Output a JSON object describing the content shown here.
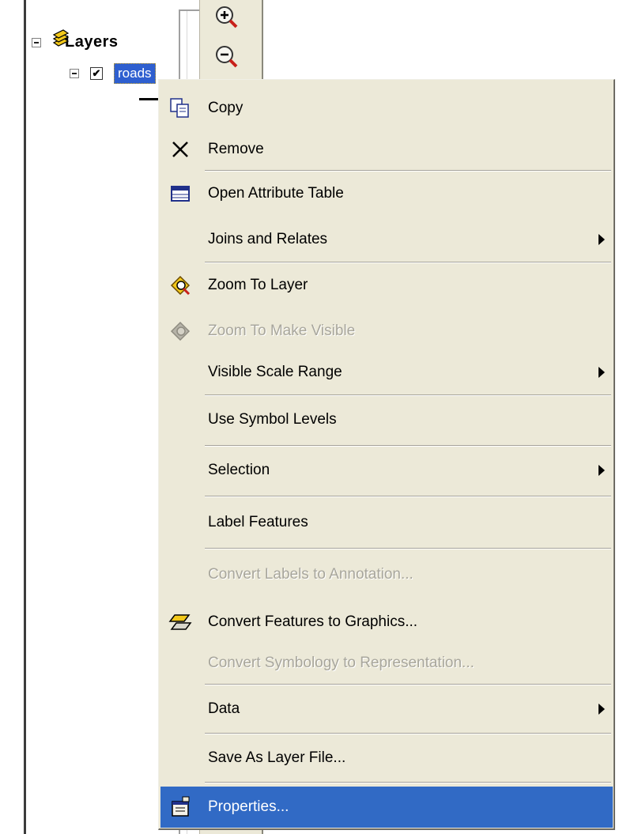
{
  "toc": {
    "root_label": "Layers",
    "layer_label": "roads",
    "layer_checked": "✔"
  },
  "toolbar": {
    "zoom_in_icon": "zoom-in-icon",
    "zoom_out_icon": "zoom-out-icon"
  },
  "menu": {
    "items": [
      {
        "label": "Copy",
        "icon": "copy-icon",
        "enabled": true,
        "submenu": false
      },
      {
        "label": "Remove",
        "icon": "remove-x-icon",
        "enabled": true,
        "submenu": false
      },
      {
        "label": "Open Attribute Table",
        "icon": "table-icon",
        "enabled": true,
        "submenu": false
      },
      {
        "label": "Joins and Relates",
        "icon": "",
        "enabled": true,
        "submenu": true
      },
      {
        "label": "Zoom To Layer",
        "icon": "zoom-to-layer-icon",
        "enabled": true,
        "submenu": false
      },
      {
        "label": "Zoom To Make Visible",
        "icon": "zoom-to-visible-icon",
        "enabled": false,
        "submenu": false
      },
      {
        "label": "Visible Scale Range",
        "icon": "",
        "enabled": true,
        "submenu": true
      },
      {
        "label": "Use Symbol Levels",
        "icon": "",
        "enabled": true,
        "submenu": false
      },
      {
        "label": "Selection",
        "icon": "",
        "enabled": true,
        "submenu": true
      },
      {
        "label": "Label Features",
        "icon": "",
        "enabled": true,
        "submenu": false
      },
      {
        "label": "Convert Labels to Annotation...",
        "icon": "",
        "enabled": false,
        "submenu": false
      },
      {
        "label": "Convert Features to Graphics...",
        "icon": "convert-graphics-icon",
        "enabled": true,
        "submenu": false
      },
      {
        "label": "Convert Symbology to Representation...",
        "icon": "",
        "enabled": false,
        "submenu": false
      },
      {
        "label": "Data",
        "icon": "",
        "enabled": true,
        "submenu": true
      },
      {
        "label": "Save As Layer File...",
        "icon": "",
        "enabled": true,
        "submenu": false
      },
      {
        "label": "Properties...",
        "icon": "properties-icon",
        "enabled": true,
        "submenu": false,
        "selected": true
      }
    ]
  },
  "colors": {
    "menu_background": "#ece9d8",
    "selection_highlight": "#316ac5",
    "disabled_text": "#a8a69c"
  }
}
